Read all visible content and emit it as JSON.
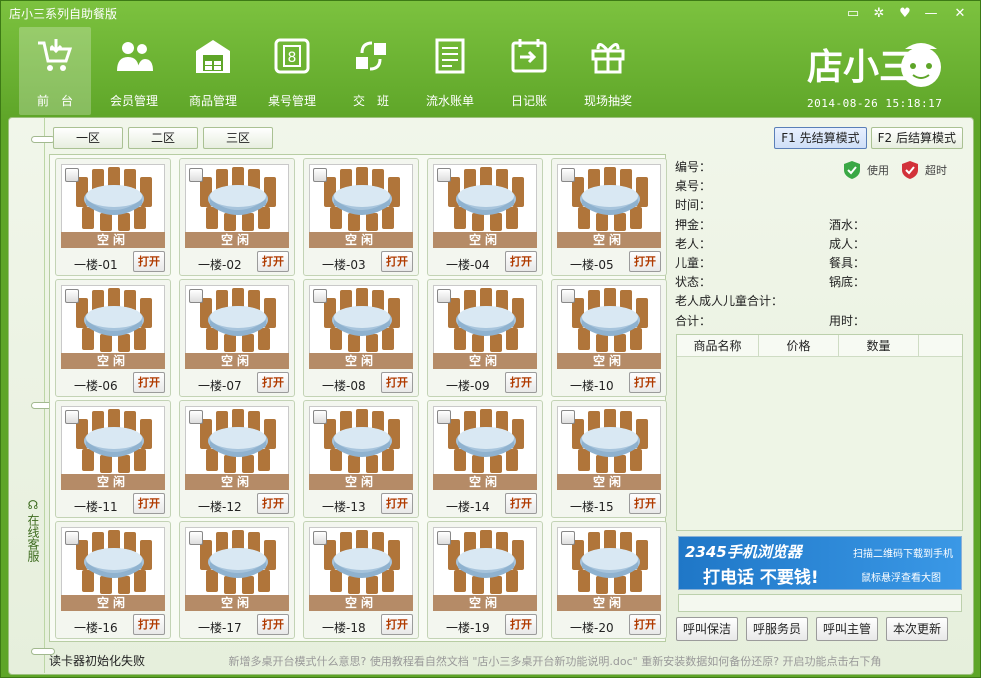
{
  "window": {
    "title": "店小三系列自助餐版",
    "controls": [
      "message-icon",
      "settings-icon",
      "skin-icon",
      "minimize-icon",
      "close-icon"
    ]
  },
  "toolbar": [
    {
      "label": "前　台",
      "icon": "cart-icon",
      "active": true
    },
    {
      "label": "会员管理",
      "icon": "members-icon",
      "active": false
    },
    {
      "label": "商品管理",
      "icon": "warehouse-icon",
      "active": false
    },
    {
      "label": "桌号管理",
      "icon": "table-number-icon",
      "active": false
    },
    {
      "label": "交　班",
      "icon": "shift-handover-icon",
      "active": false
    },
    {
      "label": "流水账单",
      "icon": "bill-icon",
      "active": false
    },
    {
      "label": "日记账",
      "icon": "journal-icon",
      "active": false
    },
    {
      "label": "现场抽奖",
      "icon": "gift-icon",
      "active": false
    }
  ],
  "brand": {
    "logo_text": "店小三",
    "datetime": "2014-08-26 15:18:17"
  },
  "sidebar": {
    "service_label": "在线客服"
  },
  "zones": [
    "一区",
    "二区",
    "三区"
  ],
  "modes": [
    {
      "label": "F1 先结算模式",
      "selected": true
    },
    {
      "label": "F2 后结算模式",
      "selected": false
    }
  ],
  "tables": [
    {
      "name": "一楼-01",
      "status": "空闲",
      "action": "打开"
    },
    {
      "name": "一楼-02",
      "status": "空闲",
      "action": "打开"
    },
    {
      "name": "一楼-03",
      "status": "空闲",
      "action": "打开"
    },
    {
      "name": "一楼-04",
      "status": "空闲",
      "action": "打开"
    },
    {
      "name": "一楼-05",
      "status": "空闲",
      "action": "打开"
    },
    {
      "name": "一楼-06",
      "status": "空闲",
      "action": "打开"
    },
    {
      "name": "一楼-07",
      "status": "空闲",
      "action": "打开"
    },
    {
      "name": "一楼-08",
      "status": "空闲",
      "action": "打开"
    },
    {
      "name": "一楼-09",
      "status": "空闲",
      "action": "打开"
    },
    {
      "name": "一楼-10",
      "status": "空闲",
      "action": "打开"
    },
    {
      "name": "一楼-11",
      "status": "空闲",
      "action": "打开"
    },
    {
      "name": "一楼-12",
      "status": "空闲",
      "action": "打开"
    },
    {
      "name": "一楼-13",
      "status": "空闲",
      "action": "打开"
    },
    {
      "name": "一楼-14",
      "status": "空闲",
      "action": "打开"
    },
    {
      "name": "一楼-15",
      "status": "空闲",
      "action": "打开"
    },
    {
      "name": "一楼-16",
      "status": "空闲",
      "action": "打开"
    },
    {
      "name": "一楼-17",
      "status": "空闲",
      "action": "打开"
    },
    {
      "name": "一楼-18",
      "status": "空闲",
      "action": "打开"
    },
    {
      "name": "一楼-19",
      "status": "空闲",
      "action": "打开"
    },
    {
      "name": "一楼-20",
      "status": "空闲",
      "action": "打开"
    }
  ],
  "info": {
    "code": "编号：",
    "table": "桌号：",
    "time": "时间：",
    "deposit": "押金：",
    "drinks": "酒水：",
    "elder": "老人：",
    "adult": "成人：",
    "child": "儿童：",
    "tableware": "餐具：",
    "state": "状态：",
    "pot": "锅底：",
    "subtotal": "老人成人儿童合计：",
    "total": "合计：",
    "duration": "用时：",
    "legend_in_use": "使用",
    "legend_overtime": "超时"
  },
  "goods": {
    "headers": [
      "商品名称",
      "价格",
      "数量"
    ]
  },
  "ad": {
    "title": "2345手机浏览器",
    "slogan": "打电话  不要钱!",
    "line1": "扫描二维码下载到手机",
    "line2": "鼠标悬浮查看大图"
  },
  "calls": [
    "呼叫保洁",
    "呼服务员",
    "呼叫主管",
    "本次更新"
  ],
  "statusbar": {
    "message": "读卡器初始化失败",
    "tips": "新增多桌开台模式什么意思? 使用教程看自然文档   \"店小三多桌开台新功能说明.doc\"   重新安装数据如何备份还原? 开启功能点击右下角"
  },
  "colors": {
    "frame_green": "#5ea528",
    "status_brown": "#b58b67",
    "open_red": "#b03a00",
    "ad_blue": "#1f77c7"
  }
}
